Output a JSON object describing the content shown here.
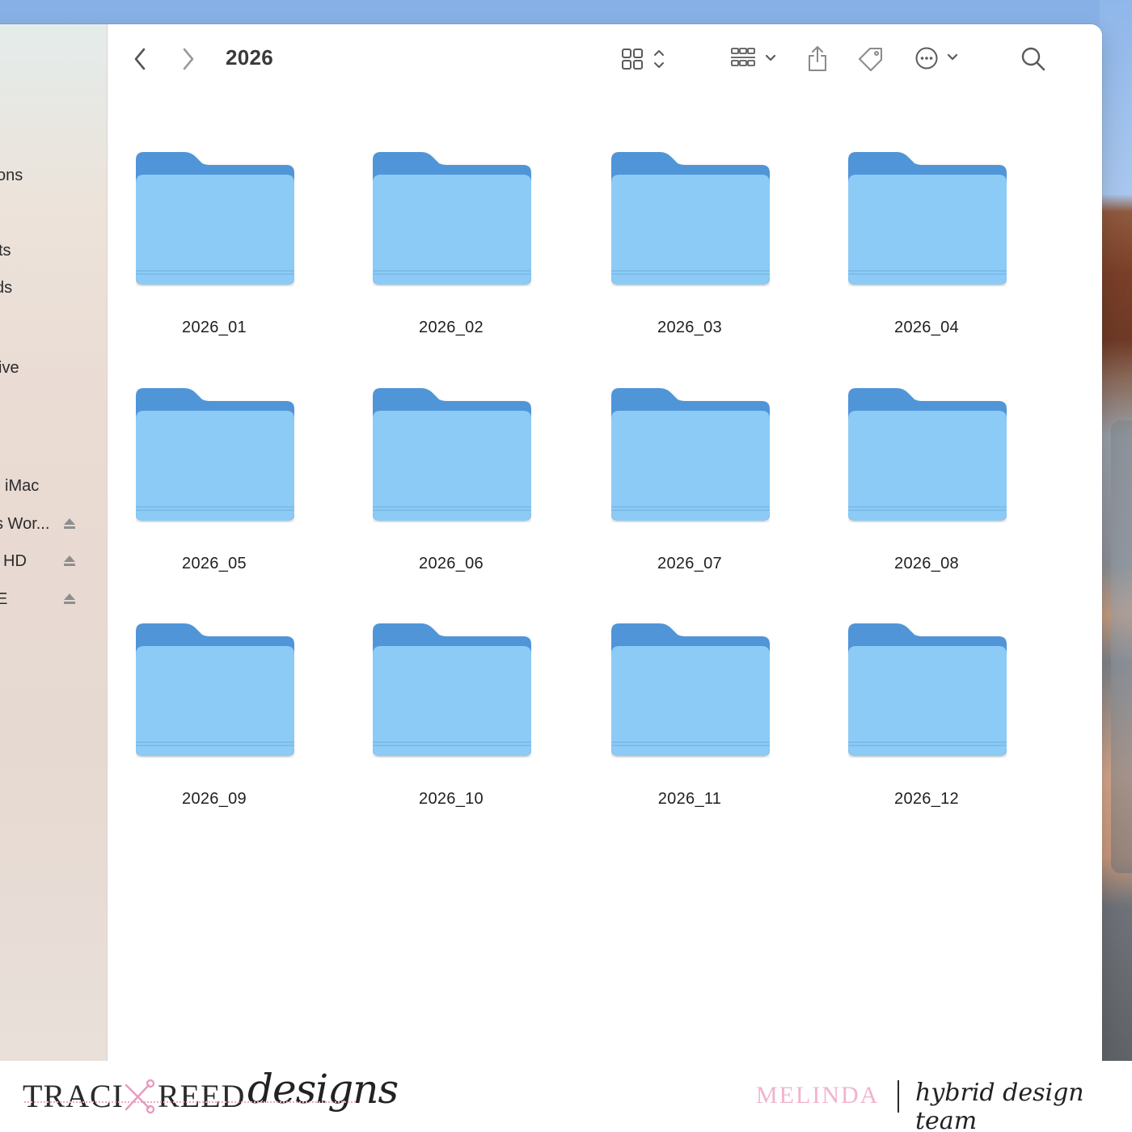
{
  "window": {
    "title": "2026",
    "toolbar": {
      "back_icon": "chevron-left-icon",
      "forward_icon": "chevron-right-icon",
      "view_icon": "icon-grid-view-icon",
      "group_icon": "group-by-icon",
      "share_icon": "share-icon",
      "tag_icon": "tag-icon",
      "action_icon": "more-actions-icon",
      "search_icon": "search-icon"
    }
  },
  "sidebar": {
    "items": [
      {
        "label": "ons",
        "eject": false
      },
      {
        "label": "ts",
        "eject": false
      },
      {
        "label": "ds",
        "eject": false
      },
      {
        "label": "ive",
        "eject": false
      },
      {
        "label": "iMac",
        "eject": false
      },
      {
        "label": "s Wor...",
        "eject": true
      },
      {
        "label": "HD",
        "eject": true
      },
      {
        "label": "E",
        "eject": true
      }
    ]
  },
  "folders": [
    {
      "name": "2026_01"
    },
    {
      "name": "2026_02"
    },
    {
      "name": "2026_03"
    },
    {
      "name": "2026_04"
    },
    {
      "name": "2026_05"
    },
    {
      "name": "2026_06"
    },
    {
      "name": "2026_07"
    },
    {
      "name": "2026_08"
    },
    {
      "name": "2026_09"
    },
    {
      "name": "2026_10"
    },
    {
      "name": "2026_11"
    },
    {
      "name": "2026_12"
    }
  ],
  "branding": {
    "traci": "TRACI",
    "reed": "REED",
    "designs": "designs",
    "member": "MELINDA",
    "team": "hybrid design team"
  },
  "colors": {
    "folder_back": "#4f95d8",
    "folder_front": "#8ccbf6",
    "accent_pink": "#f0b4cf"
  }
}
